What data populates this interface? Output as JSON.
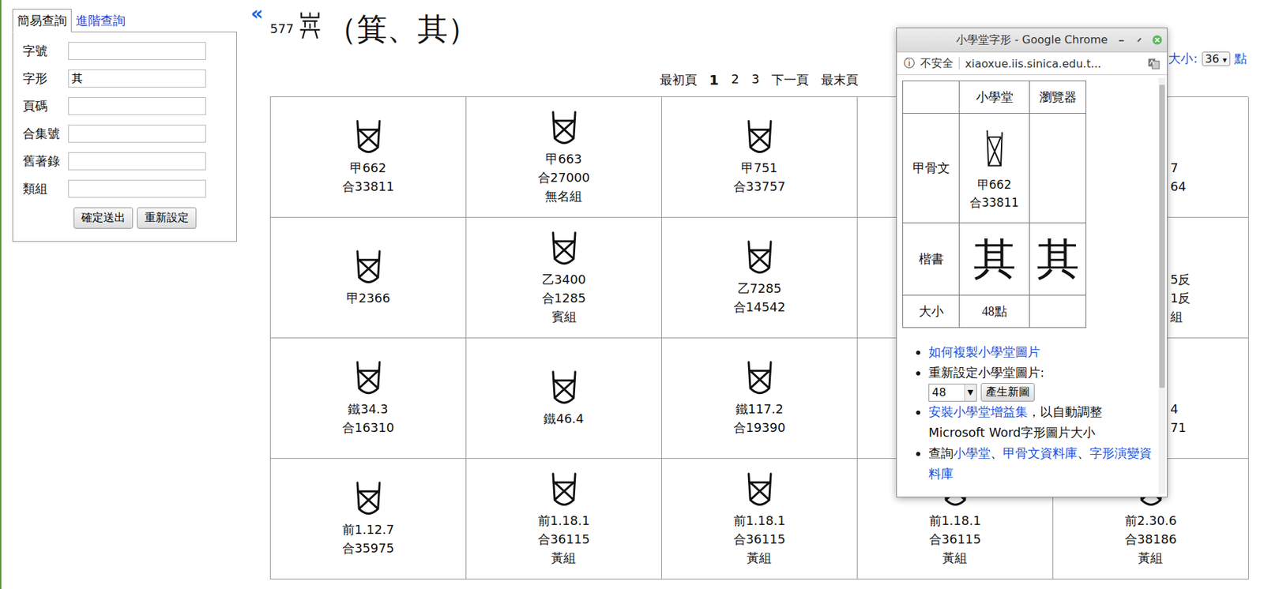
{
  "search_panel": {
    "tabs": [
      {
        "label": "簡易查詢",
        "selected": true
      },
      {
        "label": "進階查詢",
        "selected": false
      }
    ],
    "fields": [
      {
        "label": "字號",
        "value": ""
      },
      {
        "label": "字形",
        "value": "其"
      },
      {
        "label": "頁碼",
        "value": ""
      },
      {
        "label": "合集號",
        "value": ""
      },
      {
        "label": "舊著錄",
        "value": ""
      },
      {
        "label": "類組",
        "value": ""
      }
    ],
    "buttons": [
      "確定送出",
      "重新設定"
    ]
  },
  "back": "«",
  "entry": {
    "number": "577",
    "title": "（箕、其）"
  },
  "size_control": {
    "label": "大小:",
    "value": "36",
    "arrow": "▾",
    "unit": "點"
  },
  "pagination": [
    {
      "label": "最初頁",
      "selected": false
    },
    {
      "label": "1",
      "selected": true
    },
    {
      "label": "2",
      "selected": false
    },
    {
      "label": "3",
      "selected": false
    },
    {
      "label": "下一頁",
      "selected": false
    },
    {
      "label": "最末頁",
      "selected": false
    }
  ],
  "glyph_table": {
    "rows": [
      [
        {
          "kind": "full",
          "labels": [
            "甲662",
            "合33811"
          ]
        },
        {
          "kind": "full",
          "labels": [
            "甲663",
            "合27000",
            "無名組"
          ]
        },
        {
          "kind": "full",
          "labels": [
            "甲751",
            "合33757"
          ]
        },
        {
          "kind": "hidden",
          "labels": []
        },
        {
          "kind": "partial",
          "labels": [
            "7",
            "64"
          ]
        }
      ],
      [
        {
          "kind": "full",
          "labels": [
            "甲2366"
          ]
        },
        {
          "kind": "full",
          "labels": [
            "乙3400",
            "合1285",
            "賓組"
          ]
        },
        {
          "kind": "full",
          "labels": [
            "乙7285",
            "合14542"
          ]
        },
        {
          "kind": "hidden",
          "labels": []
        },
        {
          "kind": "partial",
          "labels": [
            "5反",
            "1反",
            "組"
          ]
        }
      ],
      [
        {
          "kind": "full",
          "labels": [
            "鐵34.3",
            "合16310"
          ]
        },
        {
          "kind": "full",
          "labels": [
            "鐵46.4"
          ]
        },
        {
          "kind": "full",
          "labels": [
            "鐵117.2",
            "合19390"
          ]
        },
        {
          "kind": "hidden",
          "labels": []
        },
        {
          "kind": "partial",
          "labels": [
            "4",
            "71"
          ]
        }
      ],
      [
        {
          "kind": "full",
          "labels": [
            "前1.12.7",
            "合35975"
          ]
        },
        {
          "kind": "full",
          "labels": [
            "前1.18.1",
            "合36115",
            "黃組"
          ]
        },
        {
          "kind": "full",
          "labels": [
            "前1.18.1",
            "合36115",
            "黃組"
          ]
        },
        {
          "kind": "full",
          "labels": [
            "前1.18.1",
            "合36115",
            "黃組"
          ]
        },
        {
          "kind": "full",
          "labels": [
            "前2.30.6",
            "合38186",
            "黃組"
          ]
        }
      ]
    ]
  },
  "popup": {
    "title": "小學堂字形 - Google Chrome",
    "address": {
      "icon": "ⓘ",
      "security": "不安全",
      "url": "xiaoxue.iis.sinica.edu.t..."
    },
    "table": {
      "headers": [
        "",
        "小學堂",
        "瀏覽器"
      ],
      "rows": [
        {
          "label": "甲骨文",
          "kind": "glyph",
          "xiaoxue": [
            "甲662",
            "合33811"
          ],
          "browser": ""
        },
        {
          "label": "楷書",
          "kind": "char",
          "xiaoxue": [
            "其"
          ],
          "browser": "其"
        },
        {
          "label": "大小",
          "kind": "text",
          "xiaoxue": [
            "48點"
          ],
          "browser": ""
        }
      ]
    },
    "copy_link": "如何複製小學堂圖片",
    "reset": {
      "label": "重新設定小學堂圖片:",
      "value": "48",
      "arrow": "▼",
      "button": "產生新圖"
    },
    "install": {
      "link": "安裝小學堂增益集",
      "text": "，以自動調整 Microsoft Word字形圖片大小"
    },
    "query": {
      "prefix": "查詢",
      "separator": "、",
      "links": [
        "小學堂",
        "甲骨文資料庫",
        "字形演變資料庫"
      ]
    }
  }
}
